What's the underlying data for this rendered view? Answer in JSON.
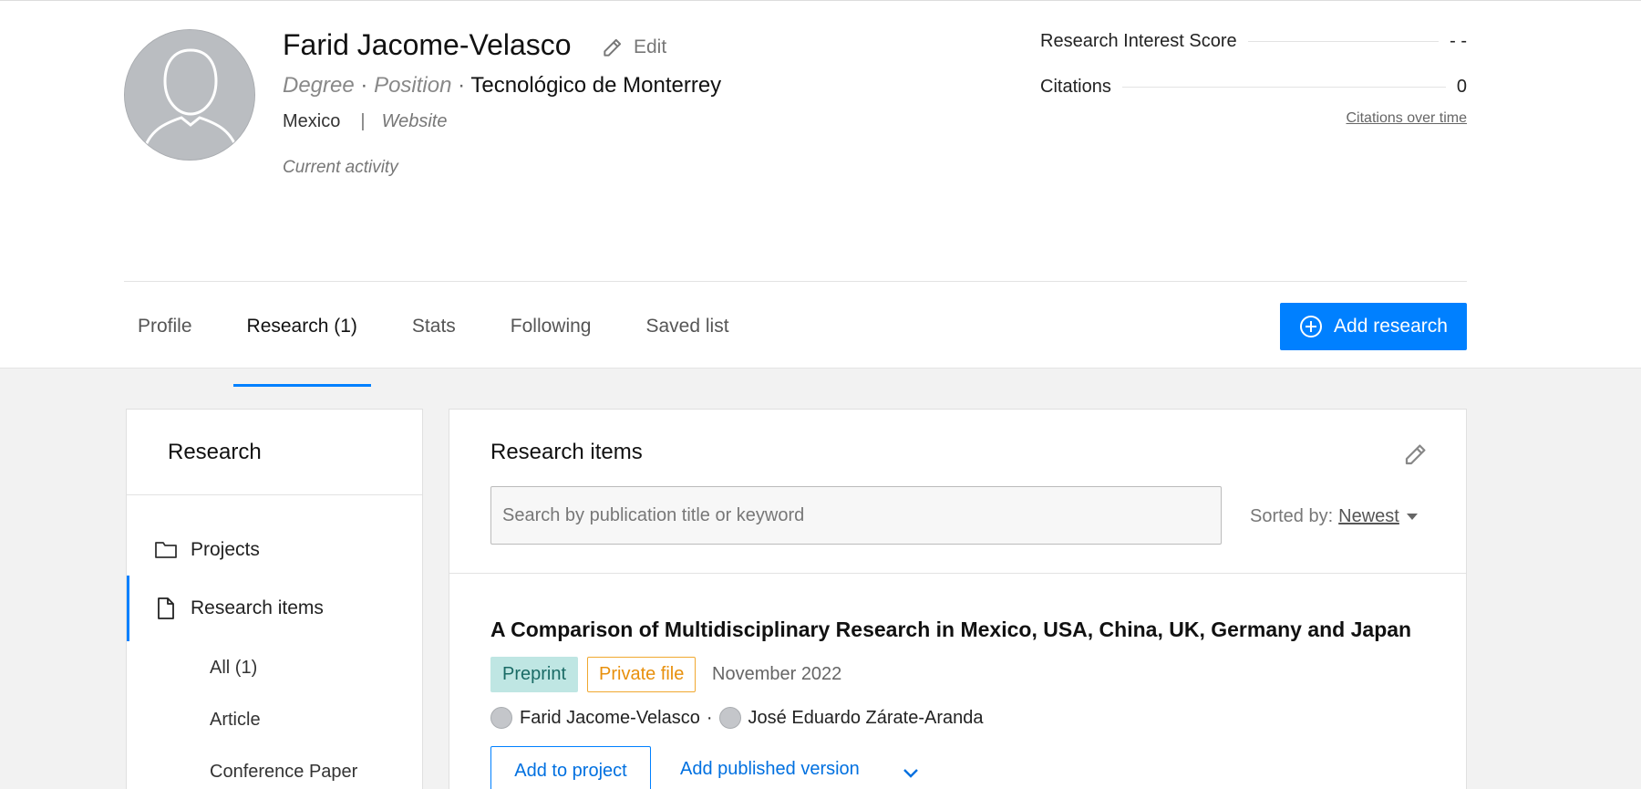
{
  "profile": {
    "name": "Farid Jacome-Velasco",
    "edit_label": "Edit",
    "degree": "Degree",
    "position": "Position",
    "institution": "Tecnológico de Monterrey",
    "separator_dot": "·",
    "country": "Mexico",
    "pipe": "|",
    "website": "Website",
    "current_activity": "Current activity"
  },
  "stats": {
    "research_interest_label": "Research Interest Score",
    "research_interest_value": "- -",
    "citations_label": "Citations",
    "citations_value": "0",
    "citations_over_time": "Citations over time"
  },
  "tabs": [
    {
      "label": "Profile"
    },
    {
      "label": "Research (1)"
    },
    {
      "label": "Stats"
    },
    {
      "label": "Following"
    },
    {
      "label": "Saved list"
    }
  ],
  "add_research_label": "Add research",
  "sidebar": {
    "title": "Research",
    "items": [
      {
        "label": "Projects",
        "icon": "folder-icon"
      },
      {
        "label": "Research items",
        "icon": "document-icon"
      }
    ],
    "sub_items": [
      {
        "label": "All (1)"
      },
      {
        "label": "Article"
      },
      {
        "label": "Conference Paper"
      }
    ]
  },
  "main": {
    "title": "Research items",
    "search_placeholder": "Search by publication title or keyword",
    "sorted_by_label": "Sorted by:",
    "sorted_by_value": "Newest",
    "publication": {
      "title": "A Comparison of Multidisciplinary Research in Mexico, USA, China, UK, Germany and Japan",
      "badge_type": "Preprint",
      "badge_access": "Private file",
      "date": "November 2022",
      "authors": [
        "Farid Jacome-Velasco",
        "José Eduardo Zárate-Aranda"
      ],
      "author_separator": "·",
      "add_to_project": "Add to project",
      "add_published_version": "Add published version"
    }
  },
  "colors": {
    "accent": "#0080ff",
    "preprint_bg": "#bfe6e3",
    "private_border": "#f0a830"
  }
}
